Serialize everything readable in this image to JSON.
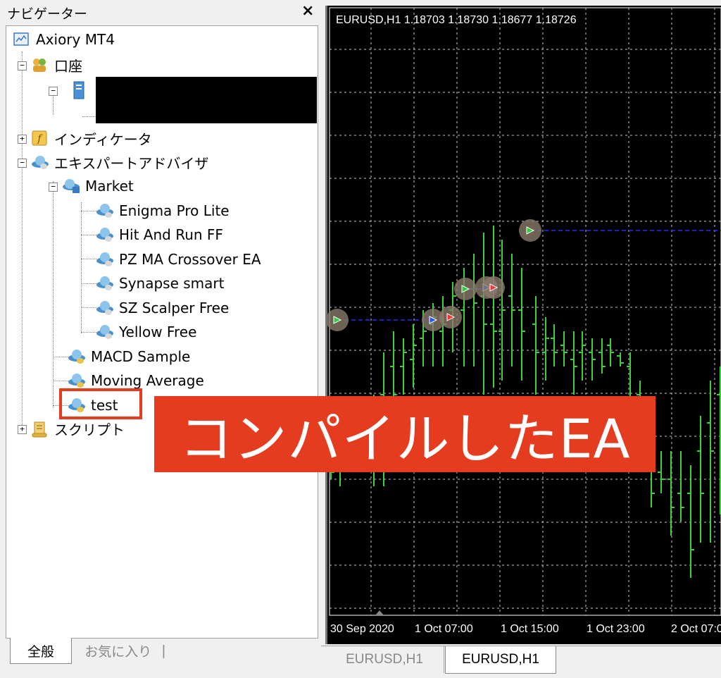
{
  "navigator": {
    "title": "ナビゲーター",
    "close_glyph": "×",
    "tree": {
      "root": "Axiory MT4",
      "accounts": "口座",
      "indicators": "インディケータ",
      "experts": "エキスパートアドバイザ",
      "market": "Market",
      "market_items": [
        "Enigma Pro Lite",
        "Hit And Run FF",
        "PZ MA Crossover EA",
        "Synapse smart",
        "SZ Scalper Free",
        "Yellow Free"
      ],
      "ea_items": [
        "MACD Sample",
        "Moving Average",
        "test"
      ],
      "scripts": "スクリプト"
    },
    "tabs": {
      "all": "全般",
      "favorites": "お気に入り"
    }
  },
  "chart": {
    "symbol_info": "EURUSD,H1  1.18703 1.18730 1.18677 1.18726",
    "time_labels": [
      "30 Sep 2020",
      "1 Oct 07:00",
      "1 Oct 15:00",
      "1 Oct 23:00",
      "2 Oct 07:00"
    ],
    "bar_color": "#3ecf3e",
    "grid_color": "#c8c8c8",
    "tabs": [
      "EURUSD,H1",
      "EURUSD,H1"
    ]
  },
  "annotation": {
    "text": "コンパイルしたEA",
    "color": "#e53c20"
  }
}
